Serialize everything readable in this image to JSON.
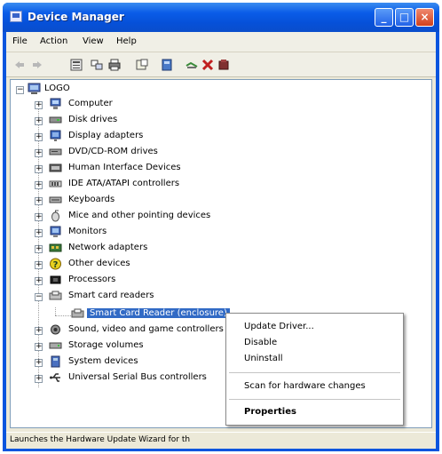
{
  "window": {
    "title": "Device Manager"
  },
  "menu": [
    "File",
    "Action",
    "View",
    "Help"
  ],
  "tree": {
    "root": "LOGO",
    "categories": [
      "Computer",
      "Disk drives",
      "Display adapters",
      "DVD/CD-ROM drives",
      "Human Interface Devices",
      "IDE ATA/ATAPI controllers",
      "Keyboards",
      "Mice and other pointing devices",
      "Monitors",
      "Network adapters",
      "Other devices",
      "Processors",
      "Smart card readers",
      "Sound, video and game controllers",
      "Storage volumes",
      "System devices",
      "Universal Serial Bus controllers"
    ],
    "selected_device": "Smart Card Reader (enclosure)"
  },
  "context_menu": {
    "items": [
      "Update Driver...",
      "Disable",
      "Uninstall",
      "Scan for hardware changes",
      "Properties"
    ]
  },
  "status_bar": "Launches the Hardware Update Wizard for th",
  "colors": {
    "title_blue": "#0a55de",
    "selection": "#316ac5",
    "window_bg": "#ece9d8"
  }
}
